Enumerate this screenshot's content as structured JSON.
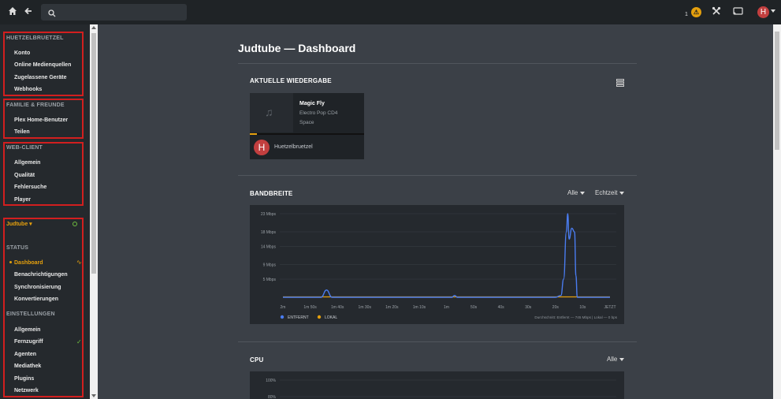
{
  "topbar": {
    "home_icon": "home-icon",
    "back_icon": "arrow-left-icon",
    "search_placeholder": "",
    "activity_count": "1",
    "activity_badge": "⚠",
    "avatar_letter": "H"
  },
  "sidebar": {
    "account_group": {
      "heading": "HUETZELBRUETZEL",
      "items": [
        "Konto",
        "Online Medienquellen",
        "Zugelassene Geräte",
        "Webhooks"
      ]
    },
    "family_group": {
      "heading": "FAMILIE & FREUNDE",
      "items": [
        "Plex Home-Benutzer",
        "Teilen"
      ]
    },
    "webclient_group": {
      "heading": "WEB-CLIENT",
      "items": [
        "Allgemein",
        "Qualität",
        "Fehlersuche",
        "Player"
      ]
    },
    "server_group": {
      "server_name": "Judtube",
      "status_heading": "STATUS",
      "status_items": [
        "Dashboard",
        "Benachrichtigungen",
        "Synchronisierung",
        "Konvertierungen"
      ],
      "settings_heading": "EINSTELLUNGEN",
      "settings_items": [
        "Allgemein",
        "Fernzugriff",
        "Agenten",
        "Mediathek",
        "Plugins",
        "Netzwerk"
      ]
    }
  },
  "main": {
    "title": "Judtube — Dashboard",
    "now_playing": {
      "heading": "AKTUELLE WIEDERGABE",
      "track": "Magic Fly",
      "album": "Electro Pop CD4",
      "artist": "Space",
      "user_initial": "H",
      "user": "Huetzelbruetzel",
      "progress": 0.06
    },
    "bandwidth": {
      "heading": "BANDBREITE",
      "filter": "Alle",
      "period": "Echtzeit",
      "legend_remote": "ENTFERNT",
      "legend_local": "LOKAL",
      "summary": "Durchschnitt: Entfernt — 745 Mbps | Lokal — 0 bps"
    },
    "cpu": {
      "heading": "CPU",
      "filter": "Alle"
    }
  },
  "colors": {
    "accent": "#e5a00d",
    "remote_series": "#4a7cf0",
    "local_series": "#e5a00d",
    "highlight_box": "#d21f1f"
  },
  "chart_data": [
    {
      "type": "line",
      "x_ticks": [
        "2m",
        "1m 50s",
        "1m 40s",
        "1m 30s",
        "1m 20s",
        "1m 10s",
        "1m",
        "50s",
        "40s",
        "30s",
        "20s",
        "10s",
        "JETZT"
      ],
      "y_ticks": [
        "23 Mbps",
        "18 Mbps",
        "14 Mbps",
        "9 Mbps",
        "5 Mbps"
      ],
      "ylim": [
        0,
        23
      ],
      "series": [
        {
          "name": "ENTFERNT",
          "color": "#4a7cf0",
          "x": [
            120,
            110,
            106,
            104,
            102,
            100,
            95,
            60,
            58,
            57,
            56,
            40,
            30,
            20,
            18,
            17,
            16,
            15.5,
            15,
            14,
            13,
            12.5,
            12,
            11,
            10,
            0
          ],
          "y": [
            0,
            0,
            0,
            2,
            0,
            0,
            0,
            0,
            0,
            0.5,
            0,
            0,
            0,
            0,
            0.5,
            5,
            18,
            23,
            16,
            19,
            18,
            6,
            0,
            0,
            0,
            0
          ]
        },
        {
          "name": "LOKAL",
          "color": "#e5a00d",
          "x": [
            120,
            0
          ],
          "y": [
            0,
            0
          ]
        }
      ]
    },
    {
      "type": "line",
      "y_ticks": [
        "100%",
        "80%"
      ],
      "ylim": [
        0,
        100
      ],
      "series": []
    }
  ]
}
